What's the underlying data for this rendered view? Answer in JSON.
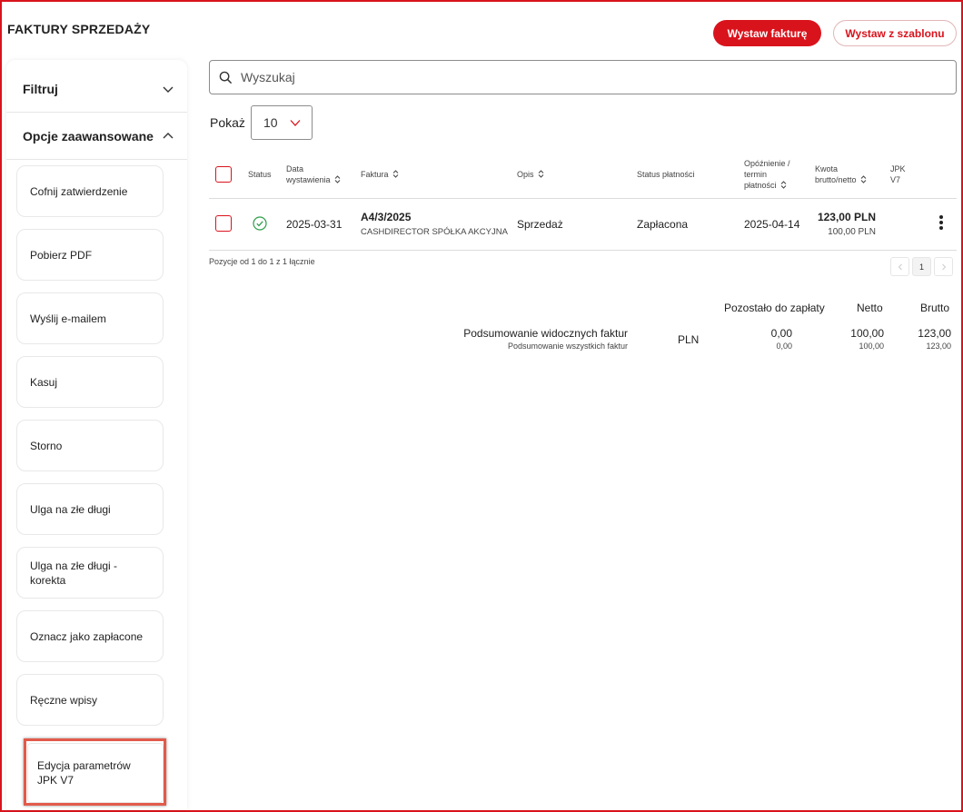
{
  "page": {
    "title": "FAKTURY SPRZEDAŻY",
    "issue_invoice_label": "Wystaw fakturę",
    "issue_from_template_label": "Wystaw z szablonu"
  },
  "sidebar": {
    "filter_label": "Filtruj",
    "advanced_label": "Opcje zaawansowane",
    "actions": [
      {
        "label": "Cofnij zatwierdzenie"
      },
      {
        "label": "Pobierz PDF"
      },
      {
        "label": "Wyślij e-mailem"
      },
      {
        "label": "Kasuj"
      },
      {
        "label": "Storno"
      },
      {
        "label": "Ulga na złe długi"
      },
      {
        "label": "Ulga na złe długi - korekta"
      },
      {
        "label": "Oznacz jako zapłacone"
      },
      {
        "label": "Ręczne wpisy"
      },
      {
        "label": "Edycja parametrów JPK V7"
      }
    ]
  },
  "search": {
    "placeholder": "Wyszukaj"
  },
  "page_size": {
    "label": "Pokaż",
    "value": "10"
  },
  "table": {
    "headers": {
      "status": "Status",
      "issue_date": "Data wystawienia",
      "invoice": "Faktura",
      "description": "Opis",
      "payment_status": "Status płatności",
      "delay": "Opóźnienie / termin płatności",
      "amount": "Kwota brutto/netto",
      "jpk": "JPK V7"
    },
    "rows": [
      {
        "issue_date": "2025-03-31",
        "invoice_number": "A4/3/2025",
        "customer": "CASHDIRECTOR SPÓŁKA AKCYJNA",
        "description": "Sprzedaż",
        "payment_status": "Zapłacona",
        "due_date": "2025-04-14",
        "gross": "123,00 PLN",
        "net": "100,00 PLN"
      }
    ],
    "info": "Pozycje od 1 do 1 z 1 łącznie",
    "current_page": "1"
  },
  "summary": {
    "col_remaining": "Pozostało do zapłaty",
    "col_net": "Netto",
    "col_gross": "Brutto",
    "visible_label": "Podsumowanie widocznych faktur",
    "all_label": "Podsumowanie wszystkich faktur",
    "currency": "PLN",
    "visible": {
      "remaining": "0,00",
      "net": "100,00",
      "gross": "123,00"
    },
    "all": {
      "remaining": "0,00",
      "net": "100,00",
      "gross": "123,00"
    }
  },
  "colors": {
    "accent": "#d9131c",
    "success": "#2e9e4b"
  }
}
